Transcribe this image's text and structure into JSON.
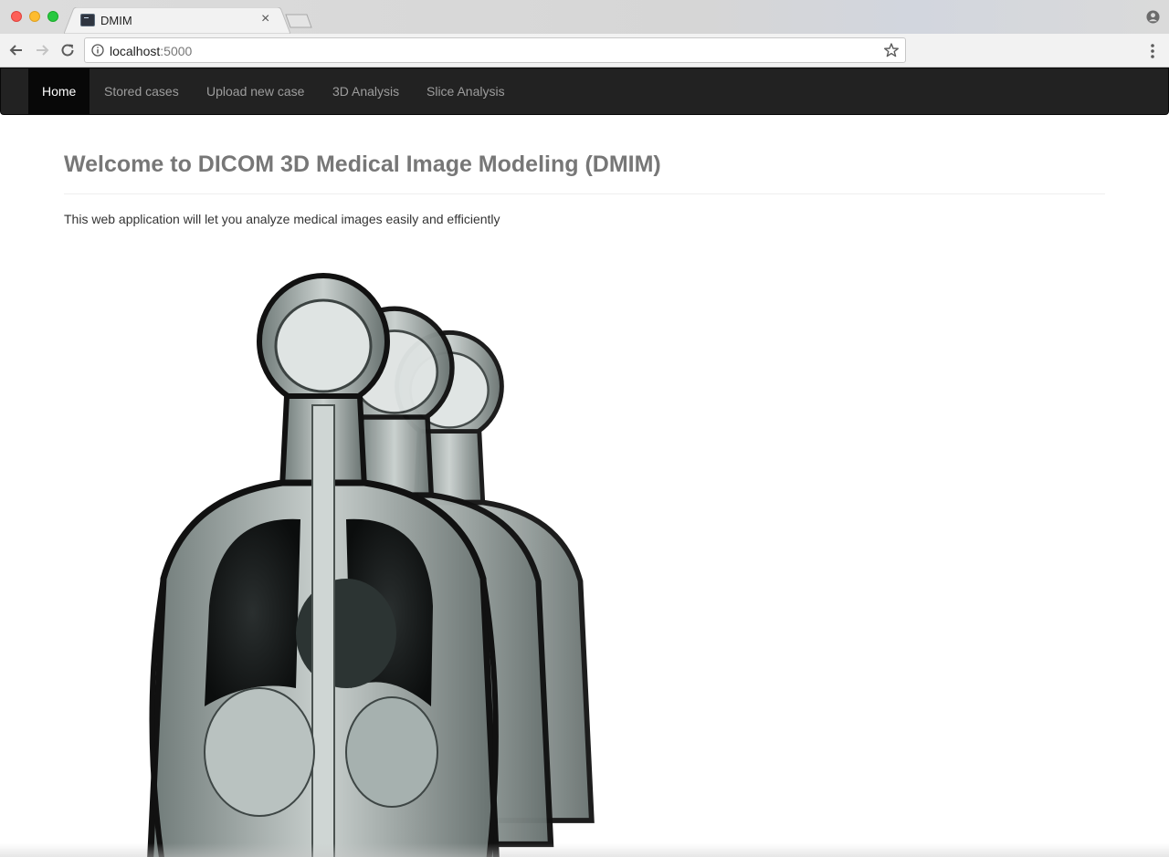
{
  "browser": {
    "tab_title": "DMIM",
    "url_host": "localhost",
    "url_port": ":5000"
  },
  "navbar": {
    "items": [
      {
        "label": "Home",
        "active": true
      },
      {
        "label": "Stored cases",
        "active": false
      },
      {
        "label": "Upload new case",
        "active": false
      },
      {
        "label": "3D Analysis",
        "active": false
      },
      {
        "label": "Slice Analysis",
        "active": false
      }
    ]
  },
  "main": {
    "title": "Welcome to DICOM 3D Medical Image Modeling (DMIM)",
    "lead": "This web application will let you analyze medical images easily and efficiently"
  },
  "colors": {
    "navbar_bg": "#222222",
    "navbar_active_bg": "#080808",
    "title_color": "#777777"
  },
  "icons": [
    "close-icon",
    "back-arrow-icon",
    "forward-arrow-icon",
    "reload-icon",
    "info-icon",
    "star-icon",
    "menu-icon",
    "profile-icon"
  ]
}
